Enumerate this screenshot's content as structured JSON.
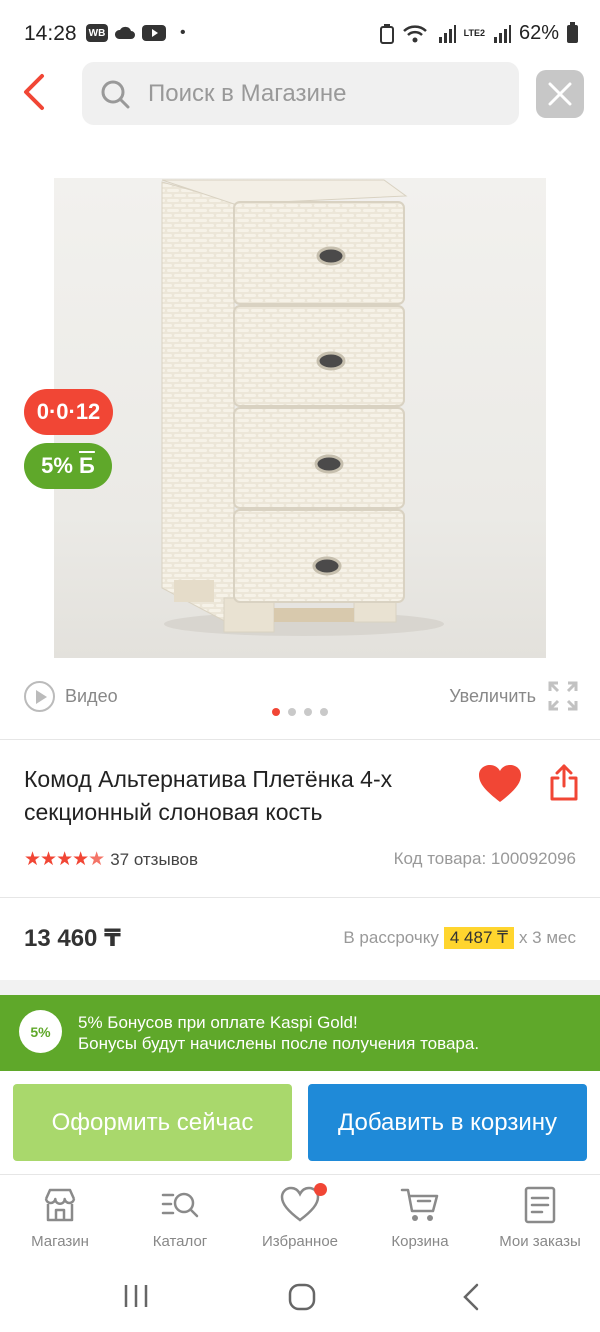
{
  "status_bar": {
    "time": "14:28",
    "app_icons": [
      "WB",
      "cloud-icon",
      "youtube-icon"
    ],
    "battery": "62%",
    "network": "LTE2"
  },
  "search": {
    "placeholder": "Поиск в Магазине"
  },
  "product": {
    "badges": {
      "installment": "0·0·12",
      "bonus": "5%",
      "bonus_currency": "Б"
    },
    "gallery": {
      "video_label": "Видео",
      "zoom_label": "Увеличить",
      "slides": 4,
      "active_slide": 1
    },
    "title": "Комод Альтернатива Плетёнка 4-х секционный слоновая кость",
    "rating": 4.5,
    "reviews": "37 отзывов",
    "code": "Код товара: 100092096",
    "price": "13 460 ₸",
    "installment": {
      "prefix": "В рассрочку",
      "amount": "4 487 ₸",
      "suffix": "х 3 мес"
    }
  },
  "bonus_banner": {
    "badge": "5%",
    "line1": "5% Бонусов при оплате Kaspi Gold!",
    "line2": "Бонусы будут начислены после получения товара."
  },
  "actions": {
    "buy_now": "Оформить сейчас",
    "add_to_cart": "Добавить в корзину"
  },
  "tabbar": {
    "items": [
      {
        "label": "Магазин"
      },
      {
        "label": "Каталог"
      },
      {
        "label": "Избранное"
      },
      {
        "label": "Корзина"
      },
      {
        "label": "Мои заказы"
      }
    ]
  },
  "colors": {
    "accent_red": "#f14635",
    "kaspi_green": "#5fa82a",
    "cart_blue": "#1f8ad8",
    "buy_green_light": "#a9d86c",
    "highlight_yellow": "#ffd52e"
  }
}
